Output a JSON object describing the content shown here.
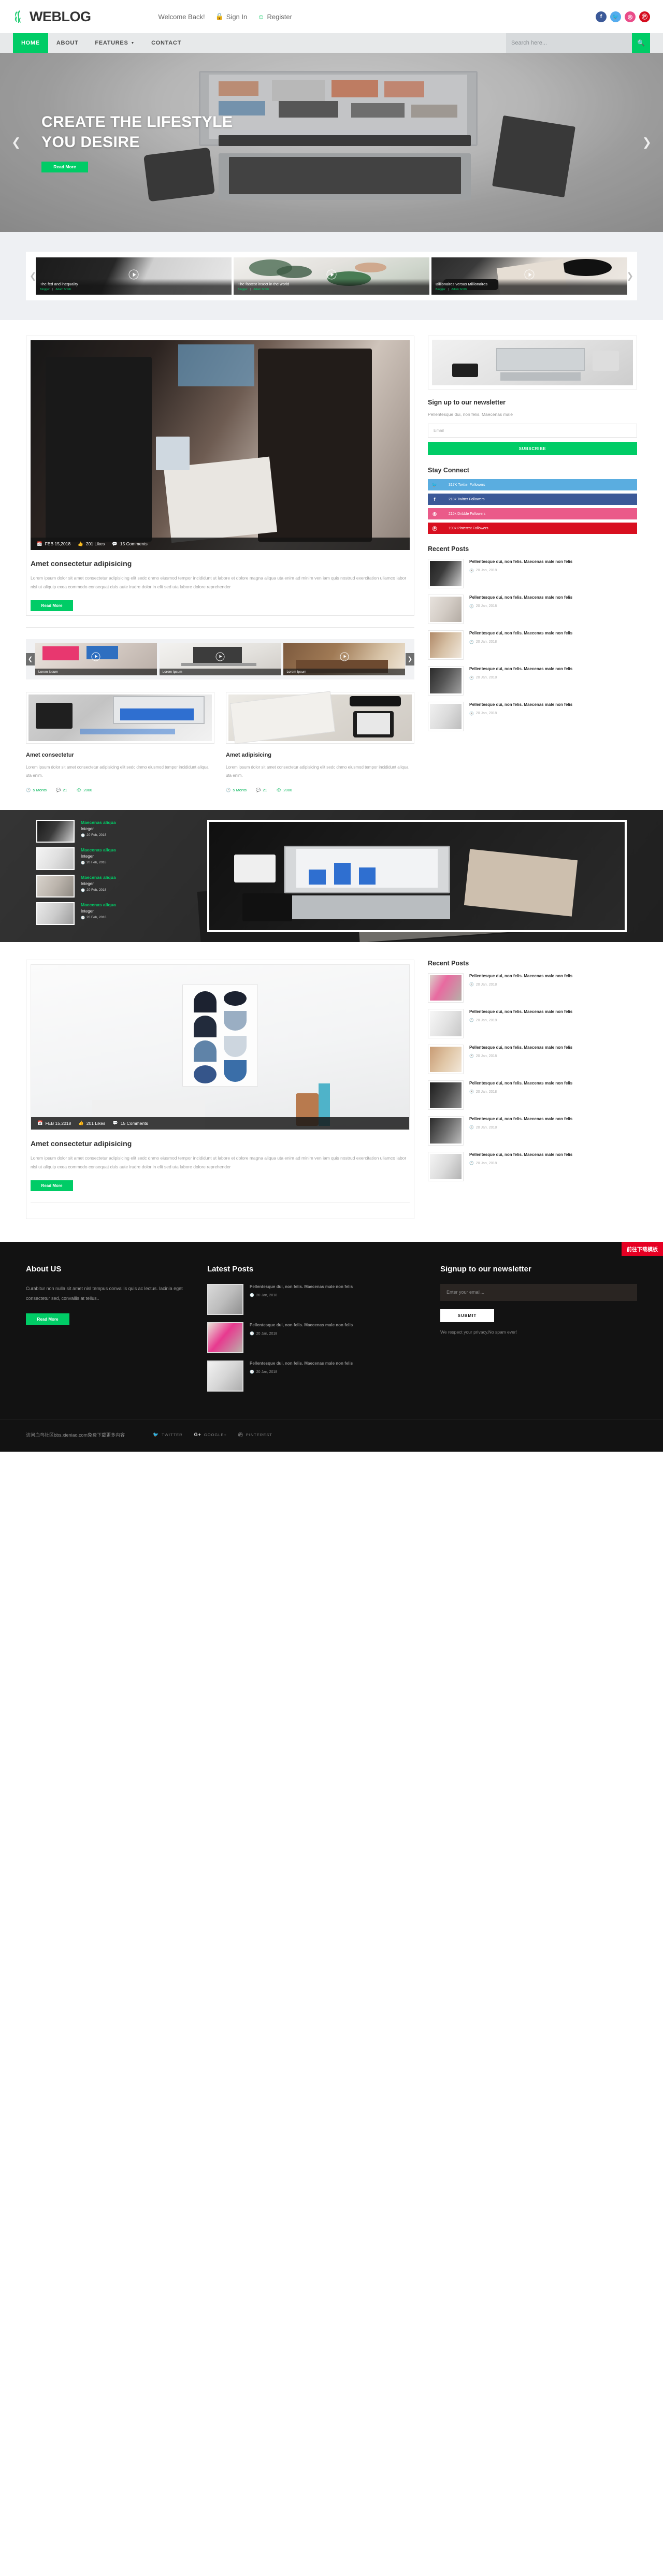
{
  "brand": {
    "name": "WEBLOG",
    "logo_icon": "leaf-icon"
  },
  "topbar": {
    "welcome_text": "Welcome Back!",
    "signin_label": "Sign In",
    "signin_icon": "lock-icon",
    "register_label": "Register",
    "register_icon": "user-icon",
    "social": [
      {
        "name": "facebook",
        "glyph": "f",
        "color": "#3b5998"
      },
      {
        "name": "twitter",
        "glyph": "t",
        "color": "#55acee"
      },
      {
        "name": "dribbble",
        "glyph": "◌",
        "color": "#ea4c89"
      },
      {
        "name": "pinterest",
        "glyph": "P",
        "color": "#d50c1f"
      }
    ]
  },
  "nav": {
    "items": [
      {
        "label": "HOME",
        "active": true,
        "caret": false
      },
      {
        "label": "ABOUT",
        "active": false,
        "caret": false
      },
      {
        "label": "FEATURES",
        "active": false,
        "caret": true
      },
      {
        "label": "CONTACT",
        "active": false,
        "caret": false
      }
    ],
    "search_placeholder": "Search here...",
    "search_icon": "search-icon",
    "accent_color": "#00cc66"
  },
  "hero": {
    "title_line1": "CREATE THE LIFESTYLE",
    "title_line2": "YOU DESIRE",
    "button_label": "Read More",
    "prev_icon": "chevron-left-icon",
    "next_icon": "chevron-right-icon"
  },
  "featured": {
    "prev_icon": "chevron-left-icon",
    "next_icon": "chevron-right-icon",
    "cards": [
      {
        "title": "The fed and inequality",
        "category": "Blogger",
        "author": "Adam Smith",
        "play_icon": "play-icon"
      },
      {
        "title": "The fastest insect in the world",
        "category": "Blogger",
        "author": "Adam Smith",
        "play_icon": "play-icon"
      },
      {
        "title": "Billionaires versus Millionaires",
        "category": "Blogger",
        "author": "Adam Smith",
        "play_icon": "play-icon"
      }
    ]
  },
  "post": {
    "date": "FEB 15,2018",
    "date_icon": "calendar-icon",
    "likes": "201 Likes",
    "likes_icon": "thumbs-up-icon",
    "comments": "15 Comments",
    "comments_icon": "comment-icon",
    "title": "Amet consectetur adipisicing",
    "body": "Lorem ipsum dolor sit amet consectetur adipisicing elit sedc dnmo eiusmod tempor incididunt ut labore et dolore magna aliqua uta enim ad minim ven iam quis nostrud exercitation ullamco labor nisi ut aliquip exea commodo consequat duis aute irudre dolor in elit sed uta labore dolore reprehender",
    "read_more": "Read More"
  },
  "video_strip": {
    "prev_icon": "chevron-left-icon",
    "next_icon": "chevron-right-icon",
    "items": [
      {
        "label": "Lorem Ipsum",
        "play_icon": "play-icon"
      },
      {
        "label": "Lorem Ipsum",
        "play_icon": "play-icon"
      },
      {
        "label": "Lorem Ipsum",
        "play_icon": "play-icon"
      }
    ]
  },
  "small_cards": [
    {
      "title": "Amet consectetur",
      "body": "Lorem ipsum dolor sit amet consectetur adipisicing elit sedc dnmo eiusmod tempor incididunt aliqua uta enim.",
      "time": "5 Monts",
      "time_icon": "clock-icon",
      "comments": "21",
      "comments_icon": "comment-icon",
      "views": "2000",
      "views_icon": "eye-icon"
    },
    {
      "title": "Amet adipisicing",
      "body": "Lorem ipsum dolor sit amet consectetur adipisicing elit sedc dnmo eiusmod tempor incididunt aliqua uta enim.",
      "time": "5 Monts",
      "time_icon": "clock-icon",
      "comments": "21",
      "comments_icon": "comment-icon",
      "views": "2000",
      "views_icon": "eye-icon"
    }
  ],
  "sidebar": {
    "newsletter_title": "Sign up to our newsletter",
    "newsletter_text": "Pellentesque dui, non felis. Maecenas male",
    "email_placeholder": "Email",
    "subscribe_label": "SUBSCRIBE",
    "connect_title": "Stay Connect",
    "connect": [
      {
        "label": "317K Twitter Followers",
        "icon": "twitter-icon",
        "glyph": "🐦",
        "class": "c-tw"
      },
      {
        "label": "218k Twitter Followers",
        "icon": "facebook-icon",
        "glyph": "f",
        "class": "c-fb"
      },
      {
        "label": "215k Dribble Followers",
        "icon": "dribbble-icon",
        "glyph": "◎",
        "class": "c-dr"
      },
      {
        "label": "190k Pinterest Followers",
        "icon": "pinterest-icon",
        "glyph": "Ⓟ",
        "class": "c-pi"
      }
    ],
    "recent_title": "Recent Posts",
    "recent": [
      {
        "title": "Pellentesque dui, non felis. Maecenas male non felis",
        "date": "20 Jan, 2018",
        "date_icon": "clock-icon"
      },
      {
        "title": "Pellentesque dui, non felis. Maecenas male non felis",
        "date": "20 Jan, 2018",
        "date_icon": "clock-icon"
      },
      {
        "title": "Pellentesque dui, non felis. Maecenas male non felis",
        "date": "20 Jan, 2018",
        "date_icon": "clock-icon"
      },
      {
        "title": "Pellentesque dui, non felis. Maecenas male non felis",
        "date": "20 Jan, 2018",
        "date_icon": "clock-icon"
      },
      {
        "title": "Pellentesque dui, non felis. Maecenas male non felis",
        "date": "20 Jan, 2018",
        "date_icon": "clock-icon"
      }
    ]
  },
  "dark_section": {
    "items": [
      {
        "title": "Maecenas aliqua",
        "subtitle": "Integer",
        "date": "20 Feb, 2018",
        "date_icon": "clock-icon"
      },
      {
        "title": "Maecenas aliqua",
        "subtitle": "Integer",
        "date": "20 Feb, 2018",
        "date_icon": "clock-icon"
      },
      {
        "title": "Maecenas aliqua",
        "subtitle": "Integer",
        "date": "20 Feb, 2018",
        "date_icon": "clock-icon"
      },
      {
        "title": "Maecenas aliqua",
        "subtitle": "Integer",
        "date": "20 Feb, 2018",
        "date_icon": "clock-icon"
      }
    ]
  },
  "bottom_post": {
    "date": "FEB 15,2018",
    "date_icon": "calendar-icon",
    "likes": "201 Likes",
    "likes_icon": "thumbs-up-icon",
    "comments": "15 Comments",
    "comments_icon": "comment-icon",
    "title": "Amet consectetur adipisicing",
    "body": "Lorem ipsum dolor sit amet consectetur adipisicing elit sedc dnmo eiusmod tempor incididunt ut labore et dolore magna aliqua uta enim ad minim ven iam quis nostrud exercitation ullamco labor nisi ut aliquip exea commodo consequat duis aute irudre dolor in elit sed uta labore dolore reprehender",
    "read_more": "Read More"
  },
  "bottom_sidebar": {
    "recent_title": "Recent Posts",
    "recent": [
      {
        "title": "Pellentesque dui, non felis. Maecenas male non felis",
        "date": "20 Jan, 2018",
        "date_icon": "clock-icon"
      },
      {
        "title": "Pellentesque dui, non felis. Maecenas male non felis",
        "date": "20 Jan, 2018",
        "date_icon": "clock-icon"
      },
      {
        "title": "Pellentesque dui, non felis. Maecenas male non felis",
        "date": "20 Jan, 2018",
        "date_icon": "clock-icon"
      },
      {
        "title": "Pellentesque dui, non felis. Maecenas male non felis",
        "date": "20 Jan, 2018",
        "date_icon": "clock-icon"
      },
      {
        "title": "Pellentesque dui, non felis. Maecenas male non felis",
        "date": "20 Jan, 2018",
        "date_icon": "clock-icon"
      },
      {
        "title": "Pellentesque dui, non felis. Maecenas male non felis",
        "date": "20 Jan, 2018",
        "date_icon": "clock-icon"
      }
    ]
  },
  "footer": {
    "about_title": "About US",
    "about_text": "Curabitur non nulla sit amet nisl tempus convallis quis ac lectus. lacinia eget consectetur sed, convallis at tellus..",
    "about_button": "Read More",
    "latest_title": "Latest Posts",
    "latest": [
      {
        "title": "Pellentesque dui, non felis. Maecenas male non felis",
        "date": "20 Jan, 2018",
        "date_icon": "clock-icon"
      },
      {
        "title": "Pellentesque dui, non felis. Maecenas male non felis",
        "date": "20 Jan, 2018",
        "date_icon": "clock-icon"
      },
      {
        "title": "Pellentesque dui, non felis. Maecenas male non felis",
        "date": "20 Jan, 2018",
        "date_icon": "clock-icon"
      }
    ],
    "signup_title": "Signup to our newsletter",
    "email_placeholder": "Enter your email...",
    "submit_label": "SUBMIT",
    "privacy_note": "We respect your privacy.No spam ever!",
    "copyright": "访问血鸟社区bbs.xieniao.com免费下载更多内容",
    "social": [
      {
        "label": "TWITTER",
        "icon": "twitter-icon",
        "glyph": "🐦"
      },
      {
        "label": "GOOGLE+",
        "icon": "google-plus-icon",
        "glyph": "G+"
      },
      {
        "label": "PINTEREST",
        "icon": "pinterest-icon",
        "glyph": "Ⓟ"
      }
    ],
    "download_badge": "前往下载模板"
  }
}
